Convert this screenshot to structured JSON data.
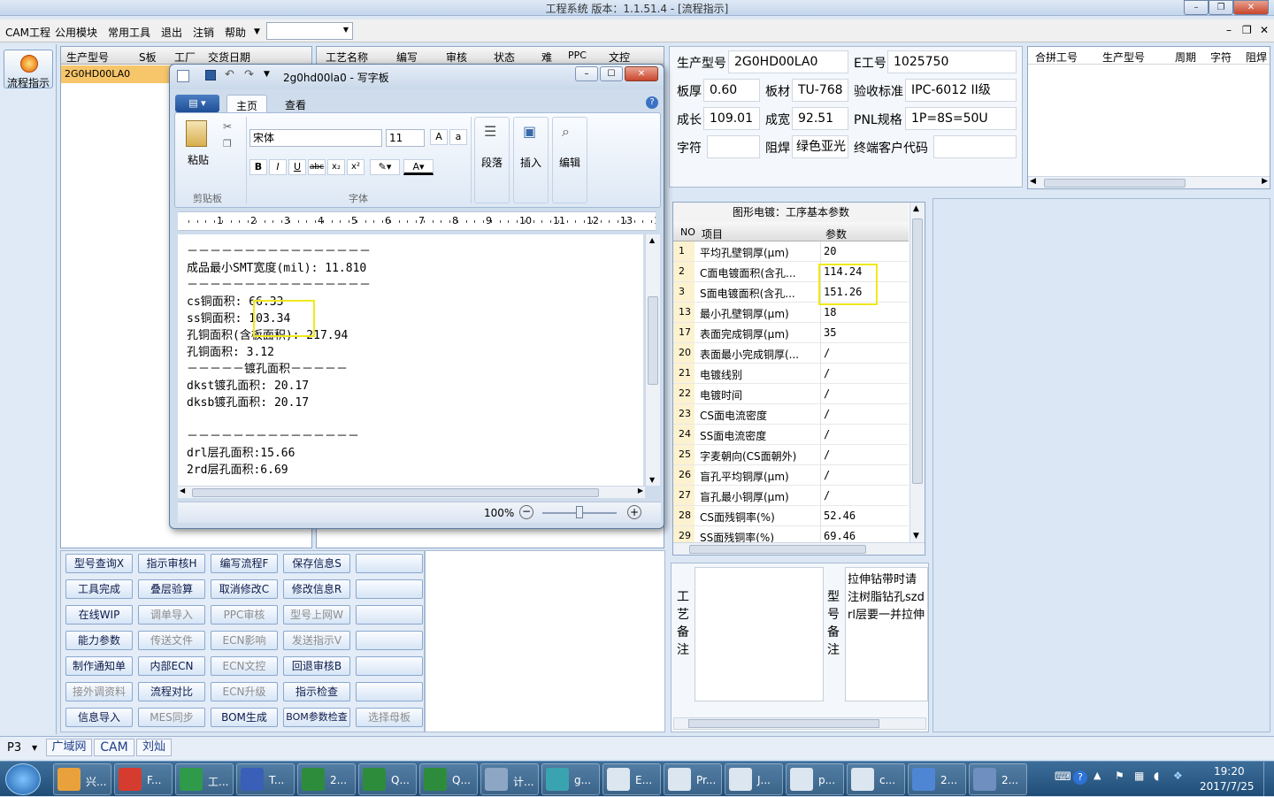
{
  "window": {
    "title": "工程系统   版本：1.1.51.4 - [流程指示]"
  },
  "menu": {
    "items": [
      "CAM工程",
      "公用模块",
      "常用工具",
      "退出",
      "注销",
      "帮助"
    ]
  },
  "nav": {
    "label": "流程指示"
  },
  "left_grid": {
    "headers": [
      "生产型号",
      "S板",
      "工厂",
      "交货日期"
    ],
    "row": "2G0HD00LA0"
  },
  "process_grid": {
    "headers": [
      "工艺名称",
      "编写",
      "审核",
      "状态",
      "难",
      "PPC",
      "文控"
    ]
  },
  "info": {
    "prod_model_label": "生产型号",
    "prod_model": "2G0HD00LA0",
    "e_no_label": "E工号",
    "e_no": "1025750",
    "thickness_label": "板厚",
    "thickness": "0.60",
    "material_label": "板材",
    "material": "TU-768",
    "accept_label": "验收标准",
    "accept": "IPC-6012 II级",
    "len_label": "成长",
    "len": "109.01",
    "wid_label": "成宽",
    "wid": "92.51",
    "pnl_label": "PNL规格",
    "pnl": "1P=8S=50U",
    "char_label": "字符",
    "char": "",
    "mask_label": "阻焊",
    "mask": "绿色亚光",
    "cust_label": "终端客户代码",
    "cust": ""
  },
  "merge_grid": {
    "headers": [
      "合拼工号",
      "生产型号",
      "周期",
      "字符",
      "阻焊"
    ]
  },
  "params": {
    "title": "图形电镀：工序基本参数",
    "headers": [
      "NO",
      "项目",
      "参数"
    ],
    "rows": [
      {
        "no": "1",
        "item": "平均孔壁铜厚(μm)",
        "val": "20"
      },
      {
        "no": "2",
        "item": "C面电镀面积(含孔...",
        "val": "114.24"
      },
      {
        "no": "3",
        "item": "S面电镀面积(含孔...",
        "val": "151.26"
      },
      {
        "no": "13",
        "item": "最小孔壁铜厚(μm)",
        "val": "18"
      },
      {
        "no": "17",
        "item": "表面完成铜厚(μm)",
        "val": "35"
      },
      {
        "no": "20",
        "item": "表面最小完成铜厚(...",
        "val": "/"
      },
      {
        "no": "21",
        "item": "电镀线别",
        "val": "/"
      },
      {
        "no": "22",
        "item": "电镀时间",
        "val": "/"
      },
      {
        "no": "23",
        "item": "CS面电流密度",
        "val": "/"
      },
      {
        "no": "24",
        "item": "SS面电流密度",
        "val": "/"
      },
      {
        "no": "25",
        "item": "字麦朝向(CS面朝外)",
        "val": "/"
      },
      {
        "no": "26",
        "item": "盲孔平均铜厚(μm)",
        "val": "/"
      },
      {
        "no": "27",
        "item": "盲孔最小铜厚(μm)",
        "val": "/"
      },
      {
        "no": "28",
        "item": "CS面残铜率(%)",
        "val": "52.46"
      },
      {
        "no": "29",
        "item": "SS面残铜率(%)",
        "val": "69.46"
      }
    ]
  },
  "remarks": {
    "craft_label": "工艺备注",
    "model_label": "型号备注",
    "model_text": "拉伸钻带时请注树脂钻孔szdrl层要一并拉伸"
  },
  "buttons": [
    [
      "型号查询X",
      "指示审核H",
      "编写流程F",
      "保存信息S",
      ""
    ],
    [
      "工具完成",
      "叠层验算",
      "取消修改C",
      "修改信息R",
      ""
    ],
    [
      "在线WIP",
      "调单导入",
      "PPC审核",
      "型号上网W",
      ""
    ],
    [
      "能力参数",
      "传送文件",
      "ECN影响",
      "发送指示V",
      ""
    ],
    [
      "制作通知单",
      "内部ECN",
      "ECN文控",
      "回退审核B",
      ""
    ],
    [
      "接外调资料",
      "流程对比",
      "ECN升级",
      "指示检查",
      ""
    ],
    [
      "信息导入",
      "MES同步",
      "BOM生成",
      "BOM参数检查",
      "选择母板"
    ]
  ],
  "disabled_buttons": [
    "调单导入",
    "PPC审核",
    "型号上网W",
    "传送文件",
    "ECN影响",
    "发送指示V",
    "ECN文控",
    "接外调资料",
    "ECN升级",
    "MES同步",
    "选择母板"
  ],
  "wordpad": {
    "title": "2g0hd00la0 - 写字板",
    "tabs": [
      "主页",
      "查看"
    ],
    "paste": "粘贴",
    "clipboard": "剪贴板",
    "font_name": "宋体",
    "font_size": "11",
    "font_group": "字体",
    "paragraph": "段落",
    "insert": "插入",
    "edit": "编辑",
    "zoom": "100%",
    "lines": [
      "－－－－－－－－－－－－－－－－",
      "成品最小SMT宽度(mil): 11.810",
      "－－－－－－－－－－－－－－－－",
      "cs铜面积: 66.33",
      "ss铜面积: 103.34",
      "孔铜面积(含板面积): 217.94",
      "孔铜面积: 3.12",
      "－－－－－镀孔面积－－－－－",
      "dkst镀孔面积: 20.17",
      "dksb镀孔面积: 20.17",
      "",
      "－－－－－－－－－－－－－－－",
      "drl层孔面积:15.66",
      "2rd层孔面积:6.69"
    ]
  },
  "status": {
    "combo": "P3",
    "tabs": [
      "广域网",
      "CAM",
      "刘灿"
    ]
  },
  "taskbar": {
    "items": [
      "兴...",
      "F...",
      "工...",
      "T...",
      "2...",
      "Q...",
      "Q...",
      "计...",
      "g...",
      "E...",
      "Pr...",
      "J...",
      "p...",
      "c...",
      "2...",
      "2..."
    ],
    "time": "19:20",
    "date": "2017/7/25"
  }
}
